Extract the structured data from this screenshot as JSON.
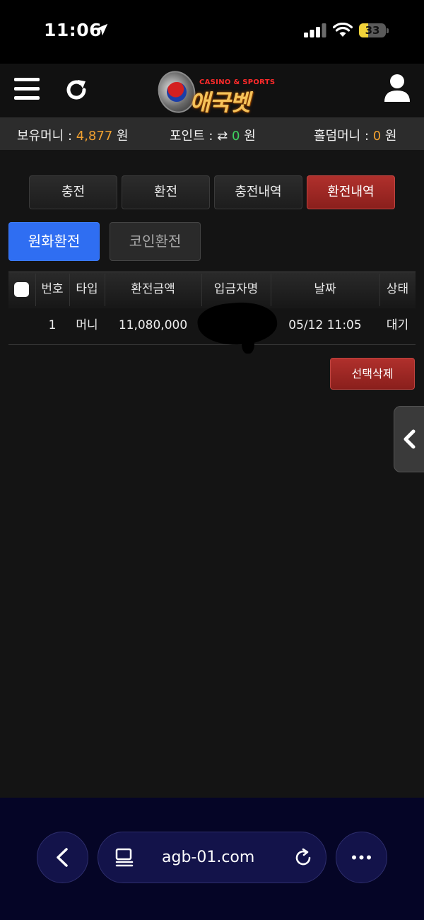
{
  "status": {
    "time": "11:06",
    "battery": "33",
    "battery_level": 0.33
  },
  "header": {
    "logo_small": "CASINO & SPORTS",
    "logo_big": "애국벳"
  },
  "balances": {
    "money_label": "보유머니 : ",
    "money_value": "4,877",
    "money_unit": " 원",
    "point_label": "포인트 : ",
    "point_value": "0",
    "point_unit": " 원",
    "holdem_label": "홀덤머니 : ",
    "holdem_value": "0",
    "holdem_unit": " 원"
  },
  "nav": {
    "tabs": [
      "충전",
      "환전",
      "충전내역",
      "환전내역"
    ],
    "active": "환전내역"
  },
  "subtabs": {
    "primary": "원화환전",
    "secondary": "코인환전"
  },
  "table": {
    "headers": [
      "번호",
      "타입",
      "환전금액",
      "입금자명",
      "날짜",
      "상태"
    ],
    "rows": [
      {
        "no": "1",
        "type": "머니",
        "amount": "11,080,000",
        "depositor": "",
        "date": "05/12 11:05",
        "status": "대기"
      }
    ]
  },
  "actions": {
    "delete_selected": "선택삭제"
  },
  "browser": {
    "url": "agb-01.com"
  },
  "colors": {
    "accent_red": "#a02824",
    "accent_blue": "#2f6ef2",
    "money_orange": "#f0a030",
    "point_green": "#3ed15e"
  }
}
